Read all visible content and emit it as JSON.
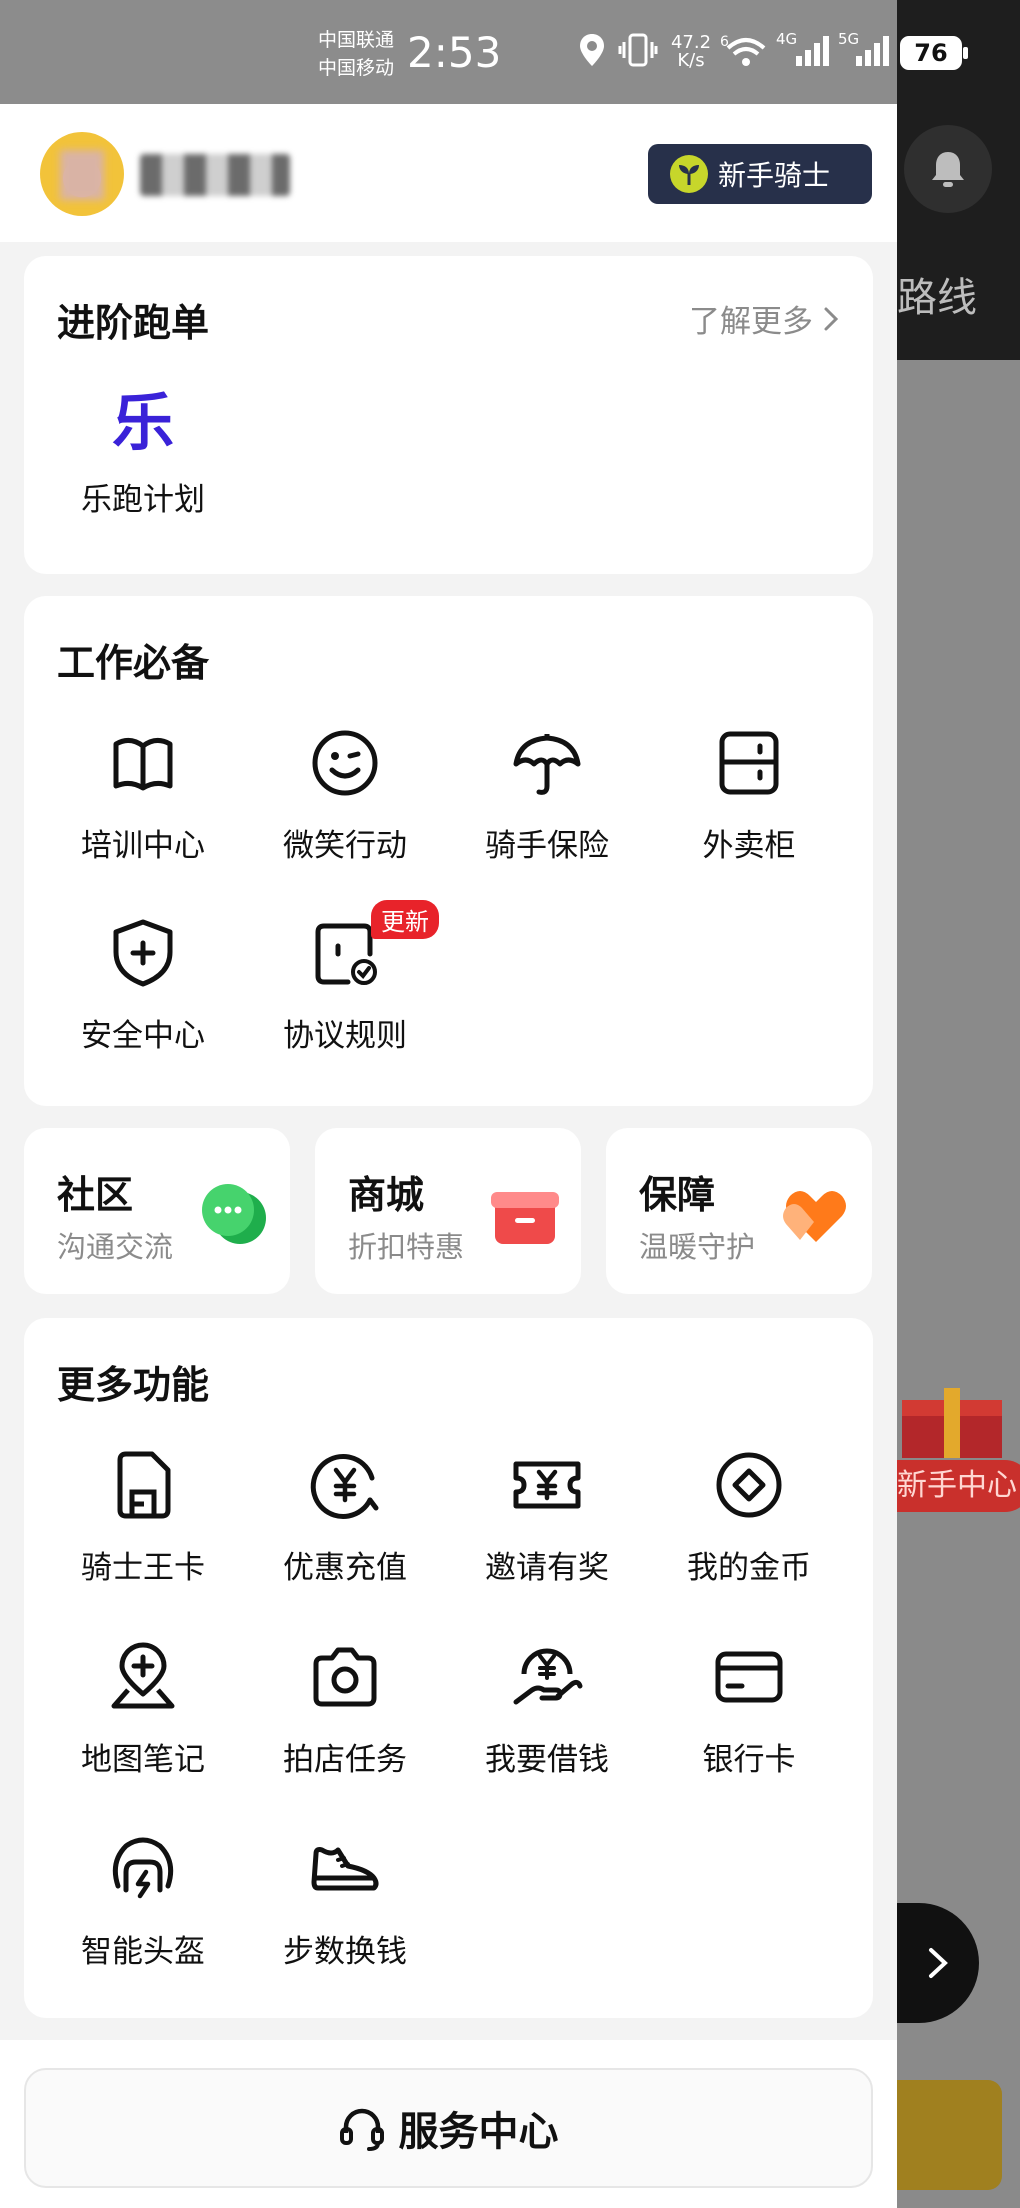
{
  "status_bar": {
    "carrier_1": "中国联通",
    "carrier_2": "中国移动",
    "time": "2:53",
    "speed_value": "47.2",
    "speed_unit": "K/s",
    "net_1": "4G",
    "net_2": "5G",
    "battery": "76"
  },
  "profile": {
    "badge_label": "新手骑士"
  },
  "advance_section": {
    "title": "进阶跑单",
    "more_label": "了解更多",
    "items": [
      {
        "glyph": "乐",
        "label": "乐跑计划",
        "icon": "lepao-logo"
      }
    ]
  },
  "work_section": {
    "title": "工作必备",
    "items": [
      {
        "label": "培训中心",
        "icon": "book-icon"
      },
      {
        "label": "微笑行动",
        "icon": "smile-icon"
      },
      {
        "label": "骑手保险",
        "icon": "umbrella-icon"
      },
      {
        "label": "外卖柜",
        "icon": "cabinet-icon"
      },
      {
        "label": "安全中心",
        "icon": "shield-plus-icon"
      },
      {
        "label": "协议规则",
        "icon": "document-check-icon",
        "tag": "更新"
      }
    ]
  },
  "mini_cards": [
    {
      "title": "社区",
      "subtitle": "沟通交流",
      "icon": "chat-bubble-icon",
      "color": "#27c45a"
    },
    {
      "title": "商城",
      "subtitle": "折扣特惠",
      "icon": "gift-box-icon",
      "color": "#f04545"
    },
    {
      "title": "保障",
      "subtitle": "温暖守护",
      "icon": "heart-icon",
      "color": "#ff8a2a"
    }
  ],
  "more_section": {
    "title": "更多功能",
    "items": [
      {
        "label": "骑士王卡",
        "icon": "sim-card-icon"
      },
      {
        "label": "优惠充值",
        "icon": "yuan-coin-icon"
      },
      {
        "label": "邀请有奖",
        "icon": "ticket-icon"
      },
      {
        "label": "我的金币",
        "icon": "coin-icon"
      },
      {
        "label": "地图笔记",
        "icon": "map-pin-plus-icon"
      },
      {
        "label": "拍店任务",
        "icon": "camera-icon"
      },
      {
        "label": "我要借钱",
        "icon": "hand-money-icon"
      },
      {
        "label": "银行卡",
        "icon": "bank-card-icon"
      },
      {
        "label": "智能头盔",
        "icon": "helmet-icon"
      },
      {
        "label": "步数换钱",
        "icon": "sneaker-icon"
      }
    ]
  },
  "service_center": {
    "label": "服务中心",
    "icon": "headset-icon"
  },
  "background_app": {
    "route_text": "路线",
    "newbie_center": "新手中心"
  },
  "colors": {
    "accent_purple": "#3a22d8",
    "badge_bg": "#27304a",
    "update_tag": "#e8232a"
  }
}
